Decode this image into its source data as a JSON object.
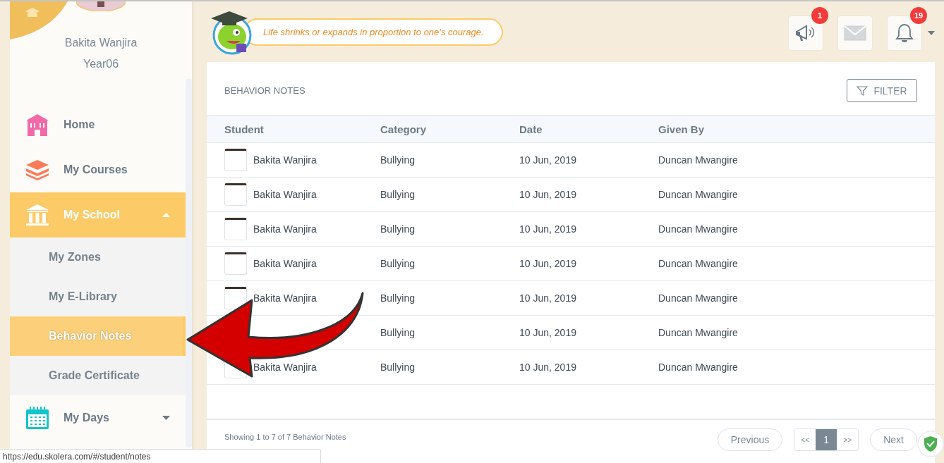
{
  "profile": {
    "name": "Bakita Wanjira",
    "grade": "Year06"
  },
  "sidebar": {
    "items": [
      {
        "kind": "home",
        "label": "Home"
      },
      {
        "kind": "courses",
        "label": "My Courses"
      },
      {
        "kind": "school",
        "label": "My School",
        "expanded": true,
        "selected": true,
        "children": [
          {
            "label": "My Zones",
            "selected": false
          },
          {
            "label": "My E-Library",
            "selected": false
          },
          {
            "label": "Behavior Notes",
            "selected": true
          },
          {
            "label": "Grade Certificate",
            "selected": false
          }
        ]
      },
      {
        "kind": "days",
        "label": "My Days",
        "expanded": false,
        "selected": false
      }
    ]
  },
  "quote": "Life shrinks or expands in proportion to one’s courage.",
  "header_icons": [
    {
      "kind": "announcement",
      "badge": "1"
    },
    {
      "kind": "mail"
    },
    {
      "kind": "bell",
      "badge": "19"
    }
  ],
  "panel": {
    "title": "BEHAVIOR NOTES",
    "filter_button": "FILTER",
    "table": {
      "columns": [
        "Student",
        "Category",
        "Date",
        "Given By"
      ],
      "rows": [
        {
          "student": "Bakita Wanjira",
          "category": "Bullying",
          "date": "10 Jun, 2019",
          "given_by": "Duncan Mwangire"
        },
        {
          "student": "Bakita Wanjira",
          "category": "Bullying",
          "date": "10 Jun, 2019",
          "given_by": "Duncan Mwangire"
        },
        {
          "student": "Bakita Wanjira",
          "category": "Bullying",
          "date": "10 Jun, 2019",
          "given_by": "Duncan Mwangire"
        },
        {
          "student": "Bakita Wanjira",
          "category": "Bullying",
          "date": "10 Jun, 2019",
          "given_by": "Duncan Mwangire"
        },
        {
          "student": "Bakita Wanjira",
          "category": "Bullying",
          "date": "10 Jun, 2019",
          "given_by": "Duncan Mwangire"
        },
        {
          "category": "Bullying",
          "date": "10 Jun, 2019",
          "given_by": "Duncan Mwangire"
        },
        {
          "student": "Bakita Wanjira",
          "category": "Bullying",
          "date": "10 Jun, 2019",
          "given_by": "Duncan Mwangire"
        }
      ]
    },
    "summary": "Showing 1 to 7 of 7 Behavior Notes",
    "pagination": {
      "previous": "Previous",
      "first": "<<",
      "pages": [
        {
          "label": "1",
          "selected": true
        }
      ],
      "last": ">>",
      "next": "Next"
    }
  },
  "status_url": "https://edu.skolera.com/#/student/notes"
}
